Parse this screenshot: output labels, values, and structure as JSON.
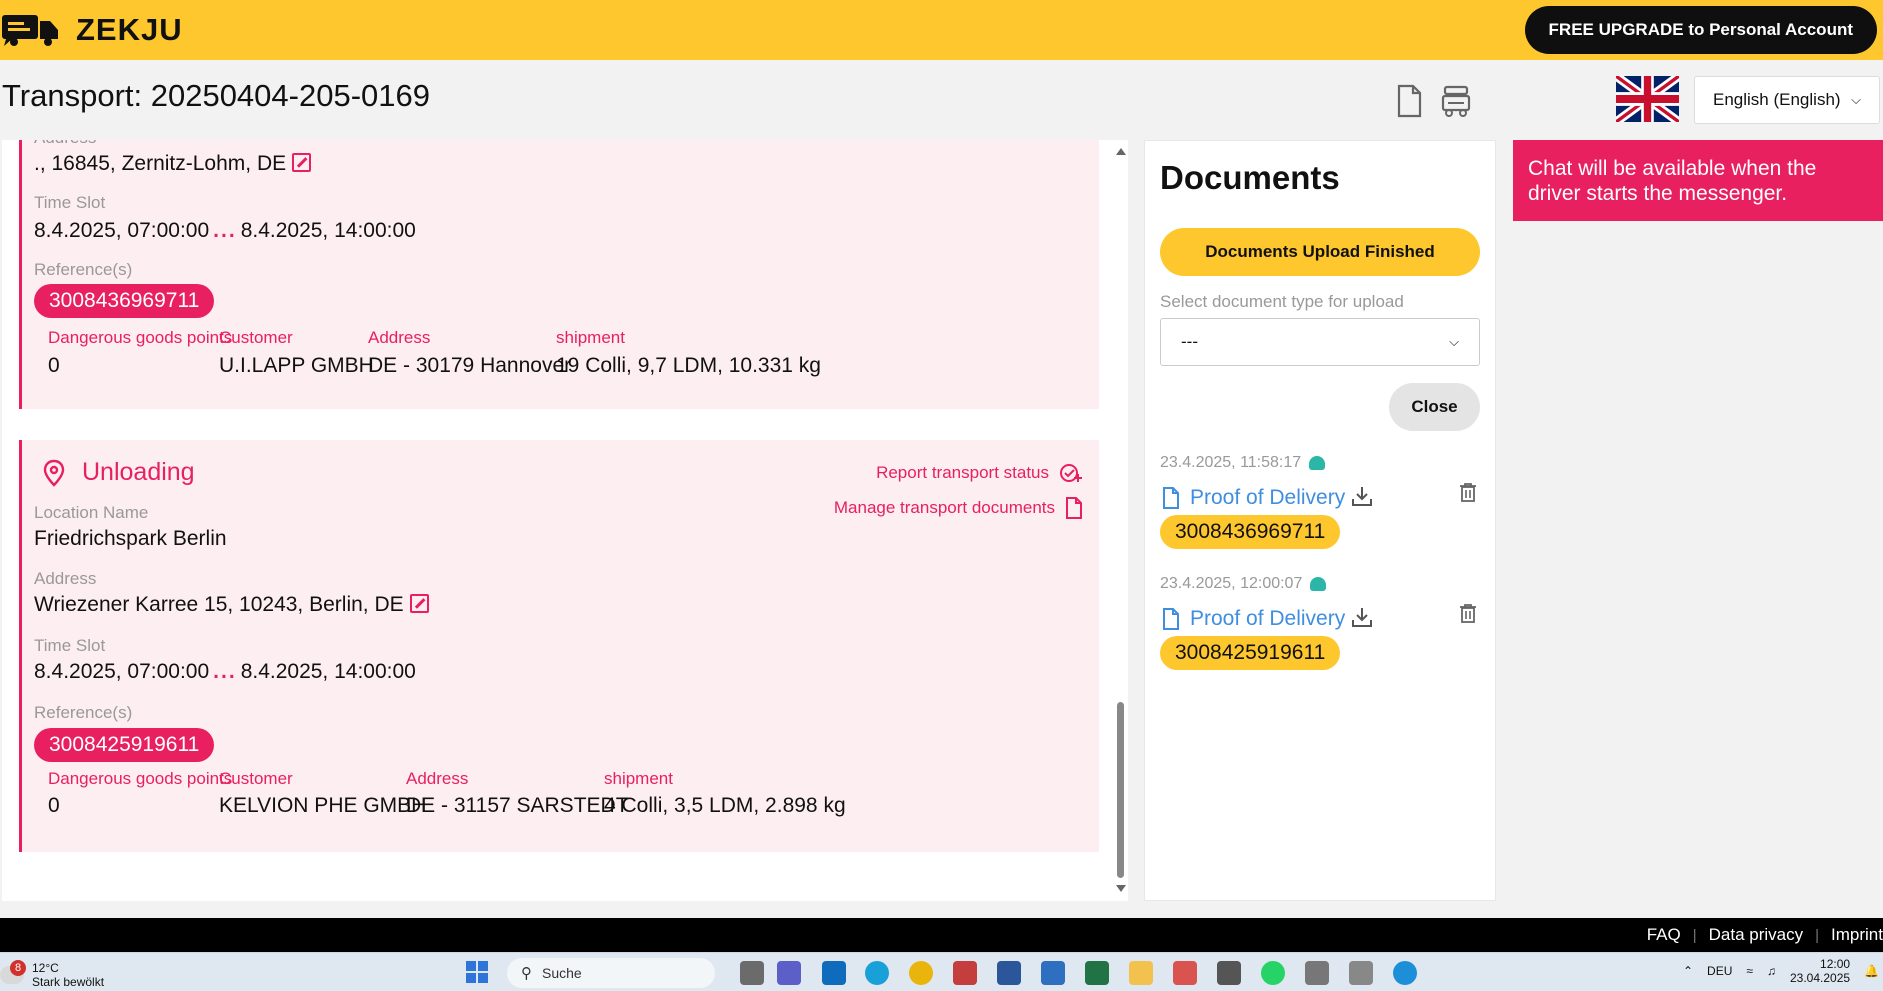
{
  "header": {
    "brand": "ZEKJU",
    "upgrade_label": "FREE UPGRADE to Personal Account"
  },
  "title_row": {
    "title": "Transport: 20250404-205-0169",
    "language": "English (English)"
  },
  "loading_stop": {
    "address_label": "Address",
    "address": "., 16845, Zernitz-Lohm, DE",
    "timeslot_label": "Time Slot",
    "time_from": "8.4.2025, 07:00:00",
    "time_sep": "...",
    "time_to": "8.4.2025, 14:00:00",
    "refs_label": "Reference(s)",
    "reference": "3008436969711",
    "details": {
      "dg_label": "Dangerous goods points",
      "dg_value": "0",
      "customer_label": "Customer",
      "customer_value": "U.I.LAPP GMBH",
      "address_label": "Address",
      "address_value": "DE - 30179 Hannover",
      "shipment_label": "shipment",
      "shipment_value": "19 Colli, 9,7 LDM, 10.331 kg"
    }
  },
  "unloading_stop": {
    "title": "Unloading",
    "report_label": "Report transport status",
    "manage_label": "Manage transport documents",
    "location_label": "Location Name",
    "location": "Friedrichspark Berlin",
    "address_label": "Address",
    "address": "Wriezener Karree 15, 10243, Berlin, DE",
    "timeslot_label": "Time Slot",
    "time_from": "8.4.2025, 07:00:00",
    "time_sep": "...",
    "time_to": "8.4.2025, 14:00:00",
    "refs_label": "Reference(s)",
    "reference": "3008425919611",
    "details": {
      "dg_label": "Dangerous goods points",
      "dg_value": "0",
      "customer_label": "Customer",
      "customer_value": "KELVION PHE GMBH",
      "address_label": "Address",
      "address_value": "DE - 31157 SARSTEDT",
      "shipment_label": "shipment",
      "shipment_value": "4 Colli, 3,5 LDM, 2.898 kg"
    }
  },
  "documents": {
    "title": "Documents",
    "upload_finished_label": "Documents Upload Finished",
    "select_label": "Select document type for upload",
    "select_value": "---",
    "close_label": "Close",
    "items": [
      {
        "time": "23.4.2025, 11:58:17",
        "name": "Proof of Delivery",
        "reference": "3008436969711"
      },
      {
        "time": "23.4.2025, 12:00:07",
        "name": "Proof of Delivery",
        "reference": "3008425919611"
      }
    ]
  },
  "chat": {
    "notice": "Chat will be available when the driver starts the messenger."
  },
  "footer": {
    "faq": "FAQ",
    "privacy": "Data privacy",
    "imprint": "Imprint"
  },
  "taskbar": {
    "notification_count": "8",
    "temperature": "12°C",
    "weather": "Stark bewölkt",
    "search": "Suche",
    "keyboard": "DEU",
    "time": "12:00",
    "date": "23.04.2025"
  },
  "colors": {
    "brand_yellow": "#fdc72d",
    "accent_pink": "#e8205f",
    "link_blue": "#3f8ee0"
  }
}
